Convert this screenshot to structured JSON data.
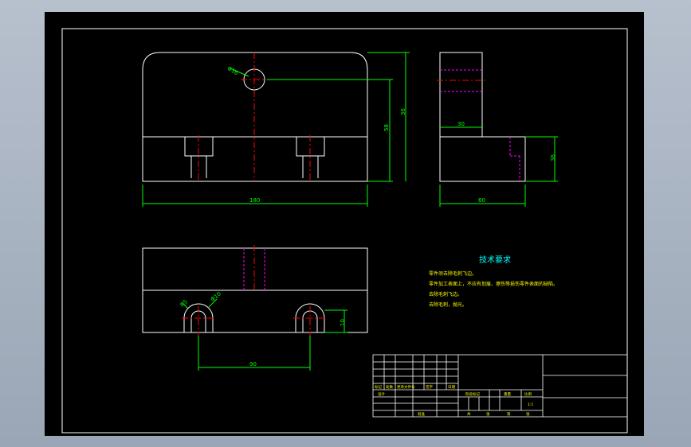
{
  "colors": {
    "background": "#000000",
    "outline": "#ffffff",
    "dimension": "#00ff00",
    "centerline": "#ff0000",
    "hidden": "#ff00ff",
    "notes": "#ffff00",
    "notes_title": "#00ffff"
  },
  "dimensions": {
    "hole_dia": "Φ16",
    "height_top": "36",
    "height_inner": "58",
    "width_front": "180",
    "side_step": "30",
    "side_width": "60",
    "side_height": "36",
    "slot_r": "R5",
    "slot_dia": "Φ10",
    "slot_pitch": "90",
    "slot_depth": "10"
  },
  "notes": {
    "title": "技术要求",
    "lines": [
      "零件须去除毛刺飞边。",
      "零件加工表面上，不应有划痕、擦伤等损伤零件表面的缺陷。",
      "去除毛刺飞边。",
      "去除毛刺，抛光。"
    ]
  },
  "title_block": {
    "row_labels": [
      "标记",
      "处数",
      "更改文件号",
      "签字",
      "日期"
    ],
    "design": "设计",
    "stage_headers": [
      "阶段标记",
      "重量",
      "比例"
    ],
    "scale": "1:1",
    "approve": "批准",
    "sheet_labels": [
      "共",
      "张",
      "第",
      "张"
    ]
  }
}
